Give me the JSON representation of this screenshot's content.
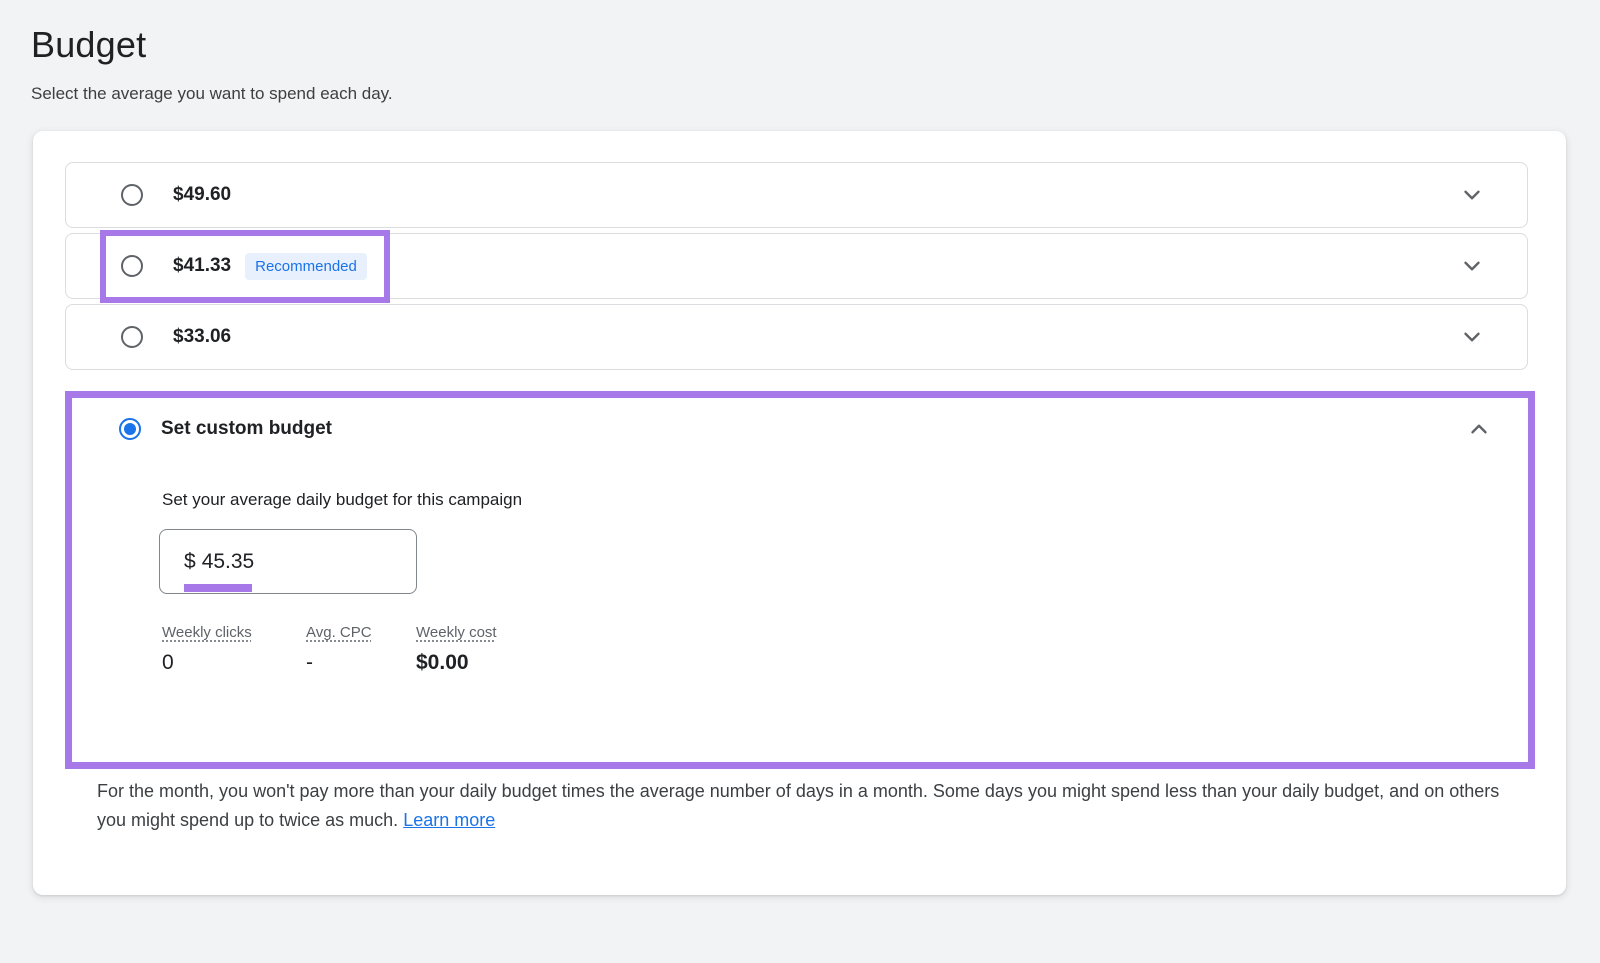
{
  "page": {
    "title": "Budget",
    "subtitle": "Select the average you want to spend each day."
  },
  "options": [
    {
      "price": "$49.60"
    },
    {
      "price": "$41.33",
      "badge": "Recommended"
    },
    {
      "price": "$33.06"
    }
  ],
  "custom_budget": {
    "title": "Set custom budget",
    "field_label": "Set your average daily budget for this campaign",
    "currency_symbol": "$",
    "amount": "45.35",
    "stats": [
      {
        "label": "Weekly clicks",
        "value": "0"
      },
      {
        "label": "Avg. CPC",
        "value": "-"
      },
      {
        "label": "Weekly cost",
        "value": "$0.00"
      }
    ]
  },
  "footer": {
    "text": "For the month, you won't pay more than your daily budget times the average number of days in a month. Some days you might spend less than your daily budget, and on others you might spend up to twice as much.",
    "link_label": "Learn more"
  },
  "icons": {
    "collapsed": "chevron-down",
    "expanded": "chevron-up"
  },
  "colors": {
    "annotation_purple": "#a678e8",
    "accent_blue": "#1a73e8",
    "badge_bg": "#e8f0fe",
    "page_bg": "#f1f3f4"
  }
}
